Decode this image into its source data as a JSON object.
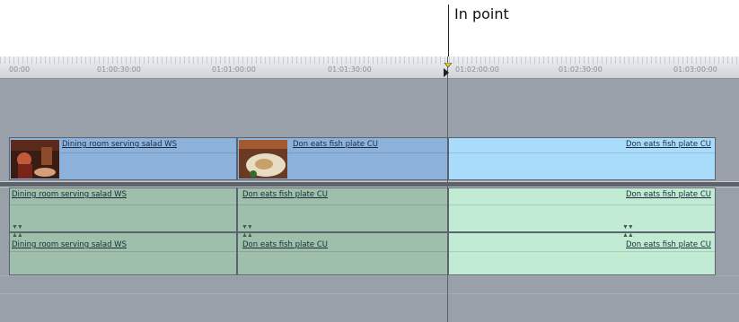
{
  "callout": {
    "label": "In point"
  },
  "ruler": {
    "timecodes": [
      "00:00",
      "01:00:30:00",
      "01:01:00:00",
      "01:01:30:00",
      "01:02:00:00",
      "01:02:30:00",
      "01:03:00:00"
    ]
  },
  "video_track": {
    "clips": [
      {
        "name": "Dining room serving salad WS",
        "selected": false
      },
      {
        "name": "Don eats fish plate CU",
        "selected": false
      },
      {
        "name": "Don eats fish plate CU",
        "selected": true
      }
    ]
  },
  "audio_track_1": {
    "clips": [
      {
        "name": "Dining room serving salad WS",
        "selected": false
      },
      {
        "name": "Don eats fish plate CU",
        "selected": false
      },
      {
        "name": "Don eats fish plate CU",
        "selected": true
      }
    ]
  },
  "audio_track_2": {
    "clips": [
      {
        "name": "Dining room serving salad WS",
        "selected": false
      },
      {
        "name": "Don eats fish plate CU",
        "selected": false
      },
      {
        "name": "Don eats fish plate CU",
        "selected": true
      }
    ]
  },
  "colors": {
    "video_clip": "#8cb2dc",
    "video_clip_selected": "#a9dbfb",
    "audio_clip": "#9ebfaa",
    "audio_clip_selected": "#c1ecd3",
    "in_point_marker": "#e8d03a"
  }
}
